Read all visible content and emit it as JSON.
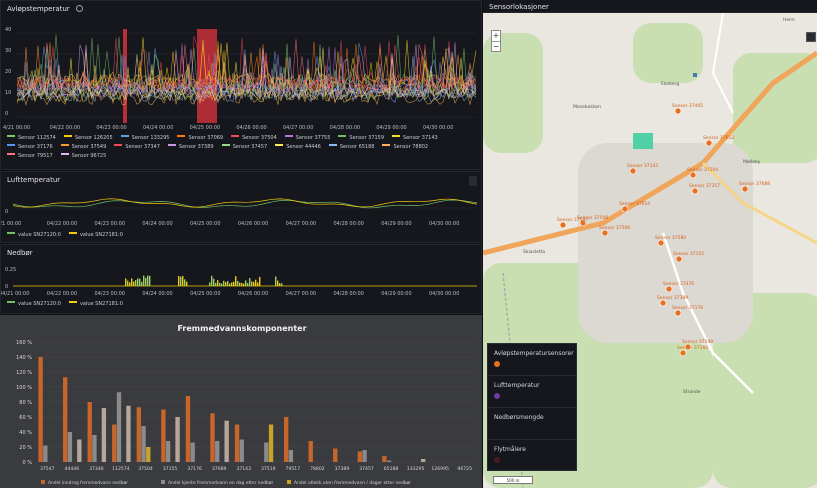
{
  "panels": {
    "avlop": {
      "title": "Avløpstemperatur",
      "yticks": [
        "40",
        "30",
        "20",
        "10",
        "0"
      ],
      "xticks": [
        "4/21 00:00",
        "04/22 00:00",
        "04/23 00:00",
        "04/24 00:00",
        "04/25 00:00",
        "04/26 00:00",
        "04/27 00:00",
        "04/28 00:00",
        "04/29 00:00",
        "04/30 00:00"
      ],
      "legend": [
        {
          "name": "Sensor 112574",
          "color": "#7bc96f"
        },
        {
          "name": "Sensor 126205",
          "color": "#f2cc0c"
        },
        {
          "name": "Sensor 133295",
          "color": "#5ba4e6"
        },
        {
          "name": "Sensor 37069",
          "color": "#ff780a"
        },
        {
          "name": "Sensor 37504",
          "color": "#f2495c"
        },
        {
          "name": "Sensor 37755",
          "color": "#b877d9"
        },
        {
          "name": "Sensor 37159",
          "color": "#73bf69"
        },
        {
          "name": "Sensor 37143",
          "color": "#fade2a"
        },
        {
          "name": "Sensor 37176",
          "color": "#5794f2"
        },
        {
          "name": "Sensor 37549",
          "color": "#ff9830"
        },
        {
          "name": "Sensor 37347",
          "color": "#f2495c"
        },
        {
          "name": "Sensor 37389",
          "color": "#ca95e5"
        },
        {
          "name": "Sensor 37457",
          "color": "#96d98d"
        },
        {
          "name": "Sensor 44446",
          "color": "#ffee52"
        },
        {
          "name": "Sensor 65188",
          "color": "#8ab8ff"
        },
        {
          "name": "Sensor 78802",
          "color": "#ffb357"
        },
        {
          "name": "Sensor 79517",
          "color": "#ff7383"
        },
        {
          "name": "Sensor 96725",
          "color": "#deb6f2"
        }
      ]
    },
    "luft": {
      "title": "Lufttemperatur",
      "ytick": "0",
      "xticks": [
        "21 00:00",
        "04/22 00:00",
        "04/23 00:00",
        "04/24 00:00",
        "04/25 00:00",
        "04/26 00:00",
        "04/27 00:00",
        "04/28 00:00",
        "04/29 00:00",
        "04/30 00:00"
      ],
      "legend": [
        {
          "name": "value SN27120:0",
          "color": "#73bf69"
        },
        {
          "name": "value SN27181:0",
          "color": "#f2cc0c"
        }
      ]
    },
    "nedbor": {
      "title": "Nedbør",
      "yticks": [
        "0.25",
        "0"
      ],
      "xticks": [
        "04/21 00:00",
        "04/22 00:00",
        "04/23 00:00",
        "04/24 00:00",
        "04/25 00:00",
        "04/26 00:00",
        "04/27 00:00",
        "04/28 00:00",
        "04/29 00:00",
        "04/30 00:00"
      ],
      "legend": [
        {
          "name": "value SN27120:0",
          "color": "#73bf69"
        },
        {
          "name": "value SN27181:0",
          "color": "#f2cc0c"
        }
      ]
    }
  },
  "chart_data": {
    "type": "bar",
    "title": "Fremmedvannskomponenter",
    "yticks": [
      "160 %",
      "140 %",
      "120 %",
      "100 %",
      "80 %",
      "60 %",
      "40 %",
      "20 %",
      "0 %"
    ],
    "ylim": [
      0,
      160
    ],
    "categories": [
      "37547",
      "44446",
      "37346",
      "112574",
      "37504",
      "37155",
      "37176",
      "37689",
      "37143",
      "37519",
      "79517",
      "78802",
      "37389",
      "37457",
      "65188",
      "133295",
      "126995",
      "96725"
    ],
    "series": [
      {
        "color": "#c8662a",
        "values": [
          140,
          113,
          80,
          50,
          73,
          70,
          88,
          65,
          50,
          0,
          60,
          28,
          18,
          14,
          8,
          0,
          0,
          0
        ]
      },
      {
        "color": "#8b8b8b",
        "values": [
          22,
          40,
          36,
          93,
          48,
          28,
          26,
          28,
          30,
          26,
          16,
          0,
          0,
          16,
          2,
          0,
          0,
          0
        ]
      },
      {
        "color": "#c9a227",
        "values": [
          0,
          0,
          0,
          0,
          20,
          0,
          0,
          0,
          0,
          50,
          0,
          0,
          0,
          0,
          0,
          0,
          0,
          0
        ]
      },
      {
        "color": "#b7a79a",
        "values": [
          0,
          30,
          72,
          75,
          0,
          60,
          0,
          55,
          0,
          0,
          0,
          0,
          0,
          0,
          0,
          4,
          0,
          0
        ]
      }
    ],
    "legend": [
      "Andel inndrag fremmedvann nedbør",
      "Andel kjente fremmedvann en dag etter nedbør",
      "Andel utlekk uten fremmedvann / dager etter nedbør"
    ]
  },
  "map": {
    "title": "Sensorlokasjoner",
    "legend": [
      {
        "label": "Avløpstemperatursensorer",
        "color": "#e8701e"
      },
      {
        "label": "Lufttemperatur",
        "color": "#6a3fa0"
      },
      {
        "label": "Nedbørsmengde",
        "color": ""
      },
      {
        "label": "Flytmålere",
        "color": "#4a1a22"
      }
    ],
    "labels": [
      "Sensor 37465",
      "Sensor 37612",
      "Sensor 37143",
      "Sensor 37504",
      "Sensor 37688",
      "Sensor 37614",
      "Sensor 37508",
      "Sensor 37506",
      "Sensor 37547",
      "Sensor 37580",
      "Sensor 37155",
      "Sensor 37476",
      "Sensor 37389",
      "Sensor 37176",
      "Sensor 37160",
      "Sensor 37549",
      "Sensor 37317"
    ],
    "place_labels": [
      "Ekeberg",
      "Mølleby",
      "Skiasletta",
      "Heim",
      "Mosebakken",
      "Strande"
    ],
    "zoom_in": "+",
    "zoom_out": "−",
    "scale": "500 m"
  }
}
